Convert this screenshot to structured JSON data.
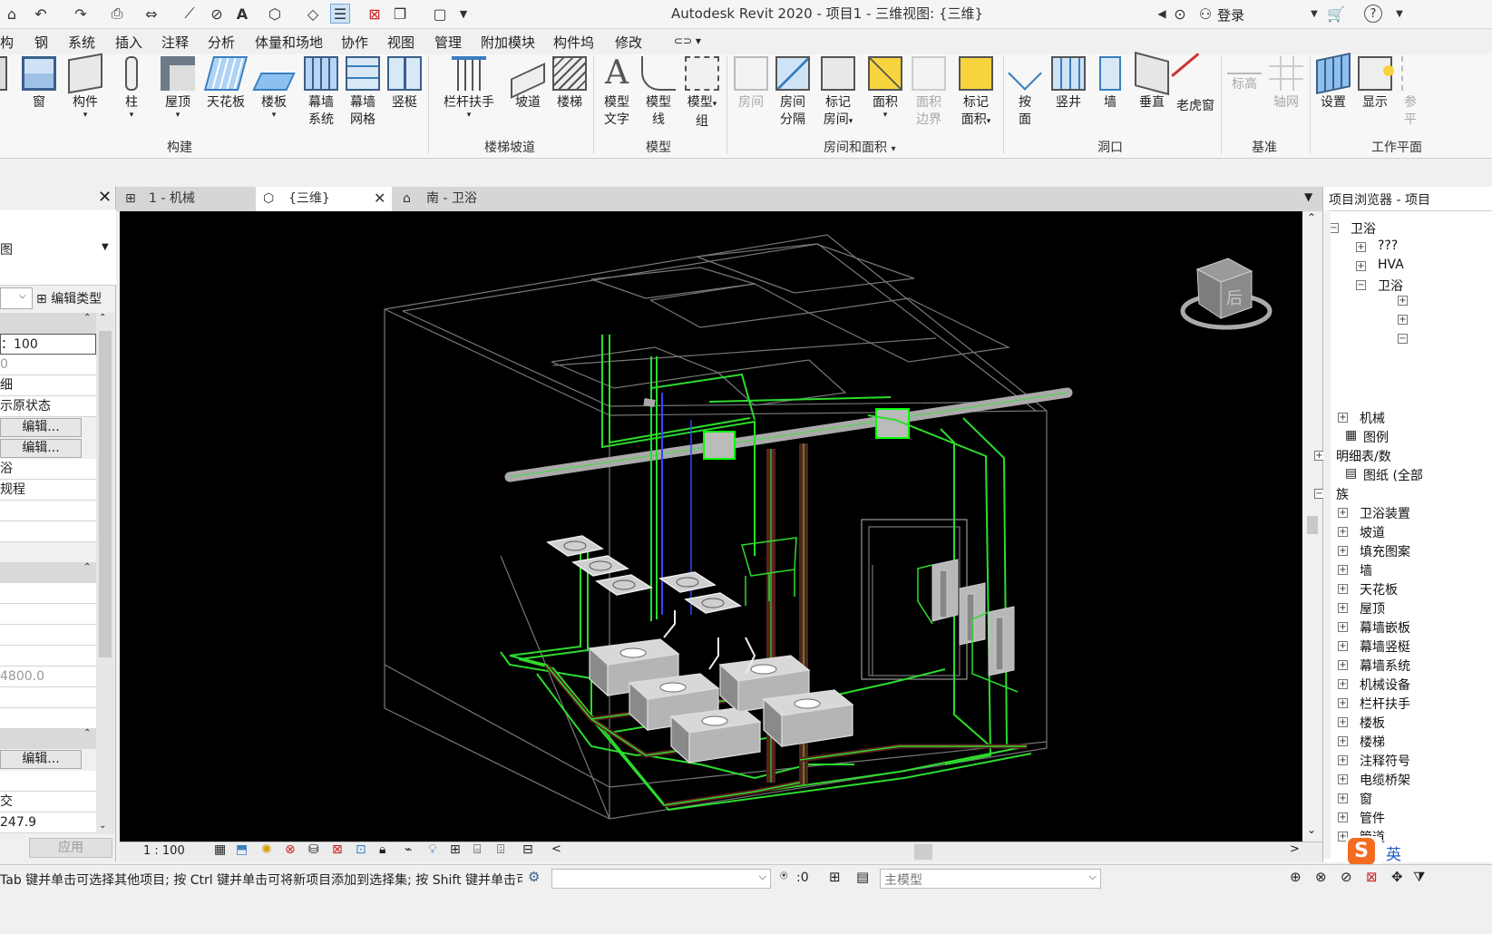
{
  "app": {
    "title": "Autodesk Revit 2020 - 项目1 - 三维视图: {三维}",
    "login": "登录"
  },
  "menu": [
    "构",
    "钢",
    "系统",
    "插入",
    "注释",
    "分析",
    "体量和场地",
    "协作",
    "视图",
    "管理",
    "附加模块",
    "构件坞",
    "修改"
  ],
  "ribbon": {
    "tools": [
      {
        "l1": "窗",
        "l2": ""
      },
      {
        "l1": "构件",
        "l2": ""
      },
      {
        "l1": "柱",
        "l2": ""
      },
      {
        "l1": "屋顶",
        "l2": ""
      },
      {
        "l1": "天花板",
        "l2": ""
      },
      {
        "l1": "楼板",
        "l2": ""
      },
      {
        "l1": "幕墙",
        "l2": "系统"
      },
      {
        "l1": "幕墙",
        "l2": "网格"
      },
      {
        "l1": "竖梃",
        "l2": ""
      },
      {
        "l1": "栏杆扶手",
        "l2": ""
      },
      {
        "l1": "坡道",
        "l2": ""
      },
      {
        "l1": "楼梯",
        "l2": ""
      },
      {
        "l1": "模型",
        "l2": "文字"
      },
      {
        "l1": "模型",
        "l2": "线"
      },
      {
        "l1": "模型",
        "l2": "组"
      },
      {
        "l1": "房间",
        "l2": ""
      },
      {
        "l1": "房间",
        "l2": "分隔"
      },
      {
        "l1": "标记",
        "l2": "房间"
      },
      {
        "l1": "面积",
        "l2": ""
      },
      {
        "l1": "面积",
        "l2": "边界"
      },
      {
        "l1": "标记",
        "l2": "面积"
      },
      {
        "l1": "按",
        "l2": "面"
      },
      {
        "l1": "竖井",
        "l2": ""
      },
      {
        "l1": "墙",
        "l2": ""
      },
      {
        "l1": "垂直",
        "l2": ""
      },
      {
        "l1": "老虎窗",
        "l2": ""
      },
      {
        "l1": "标高",
        "l2": ""
      },
      {
        "l1": "轴网",
        "l2": ""
      },
      {
        "l1": "设置",
        "l2": ""
      },
      {
        "l1": "显示",
        "l2": ""
      },
      {
        "l1": "参",
        "l2": "平"
      }
    ],
    "panels": [
      "构建",
      "楼梯坡道",
      "模型",
      "房间和面积",
      "洞口",
      "基准",
      "工作平面"
    ]
  },
  "props": {
    "type": "图",
    "edit_type": "编辑类型",
    "rows": [
      "：100",
      "0",
      "细",
      "示原状态",
      "编辑...",
      "编辑...",
      "浴",
      "规程",
      "4800.0",
      "编辑...",
      "交",
      "247.9"
    ],
    "apply": "应用"
  },
  "view_tabs": [
    "1 - 机械",
    "{三维}",
    "南 - 卫浴"
  ],
  "viewcube": {
    "face": "后"
  },
  "view_control": {
    "scale": "1 : 100"
  },
  "status": {
    "hint": "Tab 键并单击可选择其他项目; 按 Ctrl 键并单击可将新项目添加到选择集; 按 Shift 键并单击可",
    "filter": ":0",
    "model": "主模型"
  },
  "browser": {
    "title": "项目浏览器 - 项目",
    "items": [
      "卫浴",
      "???",
      "HVA",
      "卫浴",
      "机械",
      "图例",
      "明细表/数",
      "图纸 (全部",
      "族",
      "卫浴装置",
      "坡道",
      "填充图案",
      "墙",
      "天花板",
      "屋顶",
      "幕墙嵌板",
      "幕墙竖梃",
      "幕墙系统",
      "机械设备",
      "栏杆扶手",
      "楼板",
      "楼梯",
      "注释符号",
      "电缆桥架",
      "窗",
      "管件",
      "管道"
    ]
  },
  "ime": {
    "label": "英"
  }
}
